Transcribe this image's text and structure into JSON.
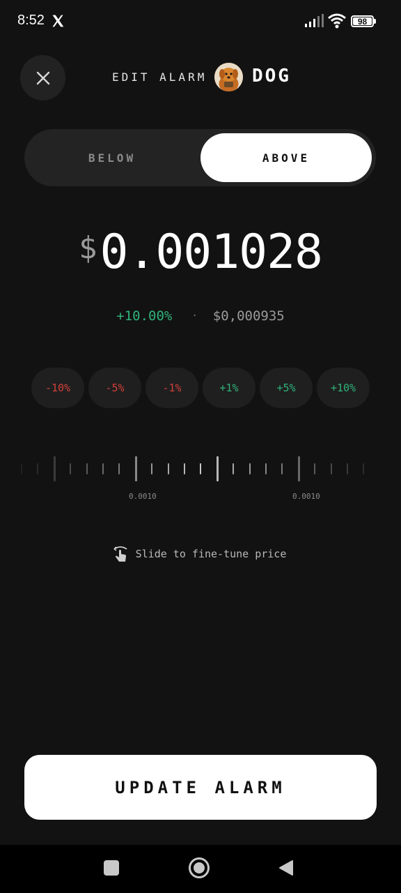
{
  "status_bar": {
    "time": "8:52",
    "battery": "98",
    "icons": [
      "x-logo-icon",
      "signal-icon",
      "wifi-icon",
      "battery-icon"
    ]
  },
  "header": {
    "close_icon": "close-icon",
    "title": "EDIT ALARM",
    "token": "DOG",
    "avatar_icon": "dog-avatar"
  },
  "toggle": {
    "below_label": "BELOW",
    "above_label": "ABOVE",
    "selected": "ABOVE"
  },
  "price": {
    "currency": "$",
    "value": "0.001028"
  },
  "change": {
    "percent": "+10.00%",
    "separator": "·",
    "reference": "$0,000935"
  },
  "chips": [
    {
      "label": "-10%",
      "type": "negative"
    },
    {
      "label": "-5%",
      "type": "negative"
    },
    {
      "label": "-1%",
      "type": "negative"
    },
    {
      "label": "+1%",
      "type": "positive"
    },
    {
      "label": "+5%",
      "type": "positive"
    },
    {
      "label": "+10%",
      "type": "positive"
    }
  ],
  "ruler": {
    "labels": [
      "0.0010",
      "0.0010"
    ]
  },
  "hint": {
    "icon": "swipe-hand-icon",
    "text": "Slide to fine-tune price"
  },
  "update_button": {
    "label": "UPDATE ALARM"
  },
  "colors": {
    "background": "#121212",
    "positive": "#2fb37b",
    "negative": "#d1403a",
    "surface": "#232323"
  }
}
